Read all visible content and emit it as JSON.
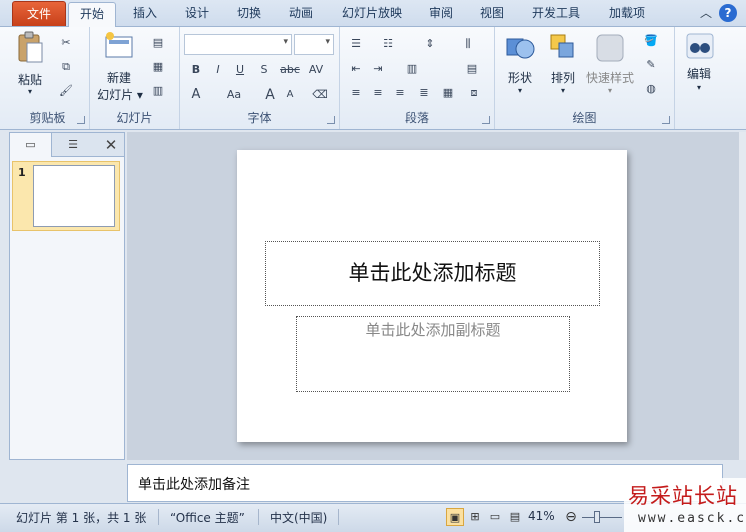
{
  "tabs": {
    "file": "文件",
    "items": [
      "开始",
      "插入",
      "设计",
      "切换",
      "动画",
      "幻灯片放映",
      "审阅",
      "视图",
      "开发工具",
      "加载项"
    ],
    "active": "开始",
    "help": "?"
  },
  "ribbon": {
    "clipboard": {
      "label": "剪贴板",
      "paste": "粘贴"
    },
    "slides": {
      "label": "幻灯片",
      "new_slide_line1": "新建",
      "new_slide_line2": "幻灯片"
    },
    "font": {
      "label": "字体",
      "bold": "B",
      "italic": "I",
      "underline": "U",
      "shadow": "S",
      "strike": "abc",
      "spacing": "AV",
      "grow": "A",
      "shrink": "A",
      "case": "Aa"
    },
    "paragraph": {
      "label": "段落"
    },
    "drawing": {
      "label": "绘图",
      "shapes": "形状",
      "arrange": "排列",
      "quick_styles": "快速样式"
    },
    "editing": {
      "label": "编辑",
      "edit": "编辑"
    }
  },
  "left_panel": {
    "slide_number": "1"
  },
  "slide": {
    "title_placeholder": "单击此处添加标题",
    "subtitle_placeholder": "单击此处添加副标题"
  },
  "notes": {
    "placeholder": "单击此处添加备注"
  },
  "status": {
    "slide_info": "幻灯片 第 1 张，共 1 张",
    "theme": "“Office 主题”",
    "language": "中文(中国)",
    "zoom": "41%"
  },
  "watermark": {
    "title": "易采站长站",
    "url": "www.easck.com"
  },
  "colors": {
    "file_tab": "#d9522a",
    "ribbon_bg": "#e3ebf5",
    "thumb_selected": "#fbe7ad"
  }
}
